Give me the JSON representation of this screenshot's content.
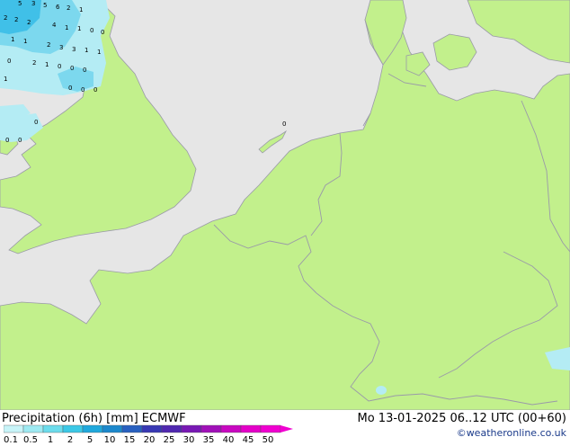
{
  "map": {
    "precip_numbers": [
      "5",
      "3",
      "5",
      "6",
      "2",
      "1",
      "2",
      "2",
      "2",
      "4",
      "1",
      "1",
      "0",
      "0",
      "1",
      "1",
      "2",
      "3",
      "3",
      "1",
      "1",
      "0",
      "2",
      "1",
      "0",
      "0",
      "0",
      "1",
      "0",
      "0",
      "0",
      "0",
      "0",
      "0",
      "0"
    ]
  },
  "legend": {
    "title": "Precipitation (6h) [mm] ECMWF",
    "valid": "Mo 13-01-2025 06..12 UTC (00+60)",
    "credit": "©weatheronline.co.uk",
    "ticks": [
      "0.1",
      "0.5",
      "1",
      "2",
      "5",
      "10",
      "15",
      "20",
      "25",
      "30",
      "35",
      "40",
      "45",
      "50"
    ],
    "colors": [
      "#c8f4f8",
      "#9eeaf2",
      "#6cdcec",
      "#3cc8e6",
      "#20a8dc",
      "#1c88cc",
      "#2860c0",
      "#3838b4",
      "#5028b0",
      "#7818b4",
      "#a010b8",
      "#c808c0",
      "#e400c8",
      "#f000d0"
    ]
  },
  "colors": {
    "sea": "#e6e6e6",
    "land": "#c2f08c",
    "border": "#9a9aa8",
    "precip_light": "#b4ecf4",
    "precip_mid": "#7cd8ee",
    "precip_heavy": "#40c0e8"
  }
}
